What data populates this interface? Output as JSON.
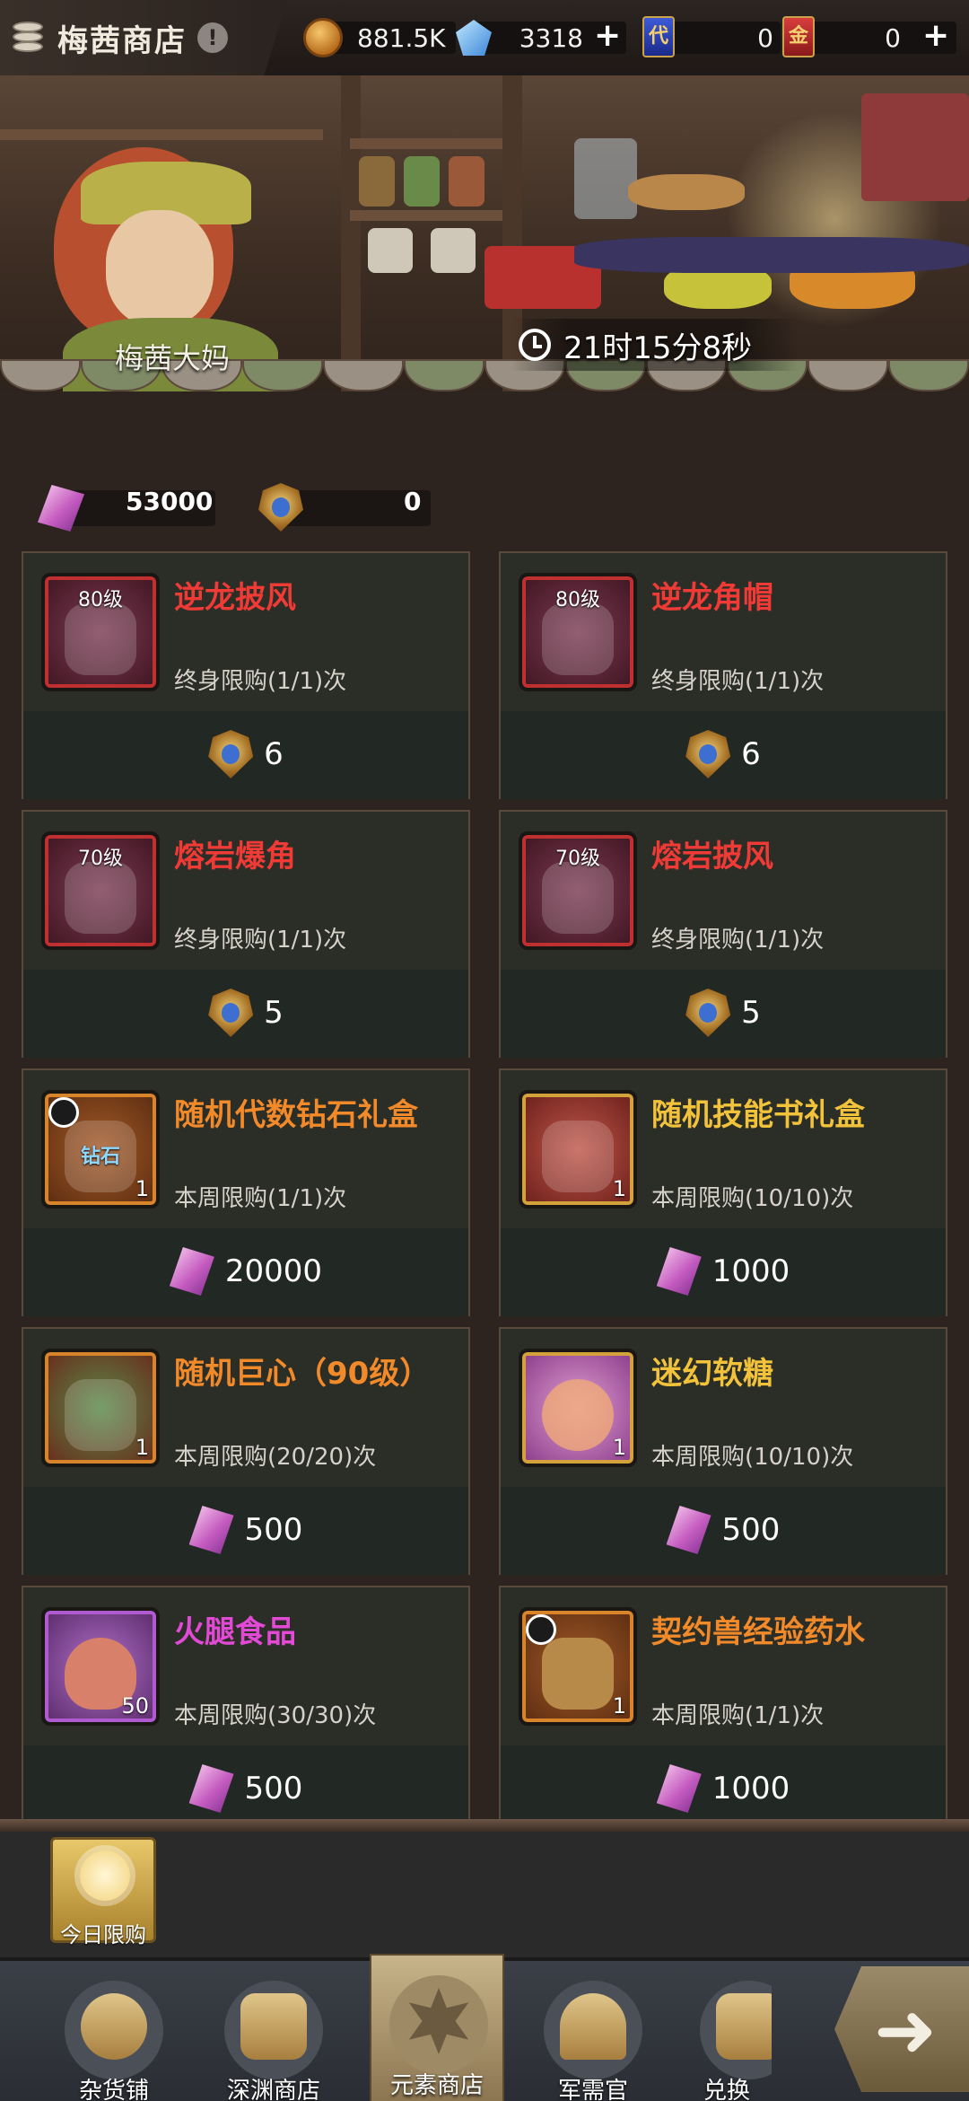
{
  "topbar": {
    "shop_title": "梅茜商店",
    "info_glyph": "!",
    "gold": "881.5K",
    "gems": "3318",
    "plus": "+",
    "dai_card_label": "代",
    "dai_count": "0",
    "jin_card_label": "金",
    "jin_count": "0"
  },
  "scene": {
    "npc_name": "梅茜大妈",
    "timer": "21时15分8秒"
  },
  "balances": {
    "crystal": "53000",
    "badge": "0"
  },
  "items": [
    {
      "name": "逆龙披风",
      "level": "80级",
      "limit": "终身限购(1/1)次",
      "price": "6"
    },
    {
      "name": "逆龙角帽",
      "level": "80级",
      "limit": "终身限购(1/1)次",
      "price": "6"
    },
    {
      "name": "熔岩爆角",
      "level": "70级",
      "limit": "终身限购(1/1)次",
      "price": "5"
    },
    {
      "name": "熔岩披风",
      "level": "70级",
      "limit": "终身限购(1/1)次",
      "price": "5"
    },
    {
      "name": "随机代数钻石礼盒",
      "qty": "1",
      "art_text": "钻石",
      "limit": "本周限购(1/1)次",
      "price": "20000"
    },
    {
      "name": "随机技能书礼盒",
      "qty": "1",
      "limit": "本周限购(10/10)次",
      "price": "1000"
    },
    {
      "name": "随机巨心（90级）",
      "qty": "1",
      "limit": "本周限购(20/20)次",
      "price": "500"
    },
    {
      "name": "迷幻软糖",
      "qty": "1",
      "limit": "本周限购(10/10)次",
      "price": "500"
    },
    {
      "name": "火腿食品",
      "qty": "50",
      "limit": "本周限购(30/30)次",
      "price": "500"
    },
    {
      "name": "契约兽经验药水",
      "qty": "1",
      "limit": "本周限购(1/1)次",
      "price": "1000"
    }
  ],
  "today_limited": "今日限购",
  "nav": {
    "tab1": "杂货铺",
    "tab2": "深渊商店",
    "tab3": "元素商店",
    "tab4": "军需官",
    "tab5": "兑换"
  },
  "colors": {
    "rarity_red": "#ef3a36",
    "rarity_orange": "#f28a2a",
    "rarity_yellow": "#f2c23a",
    "rarity_magenta": "#e24ad6"
  }
}
